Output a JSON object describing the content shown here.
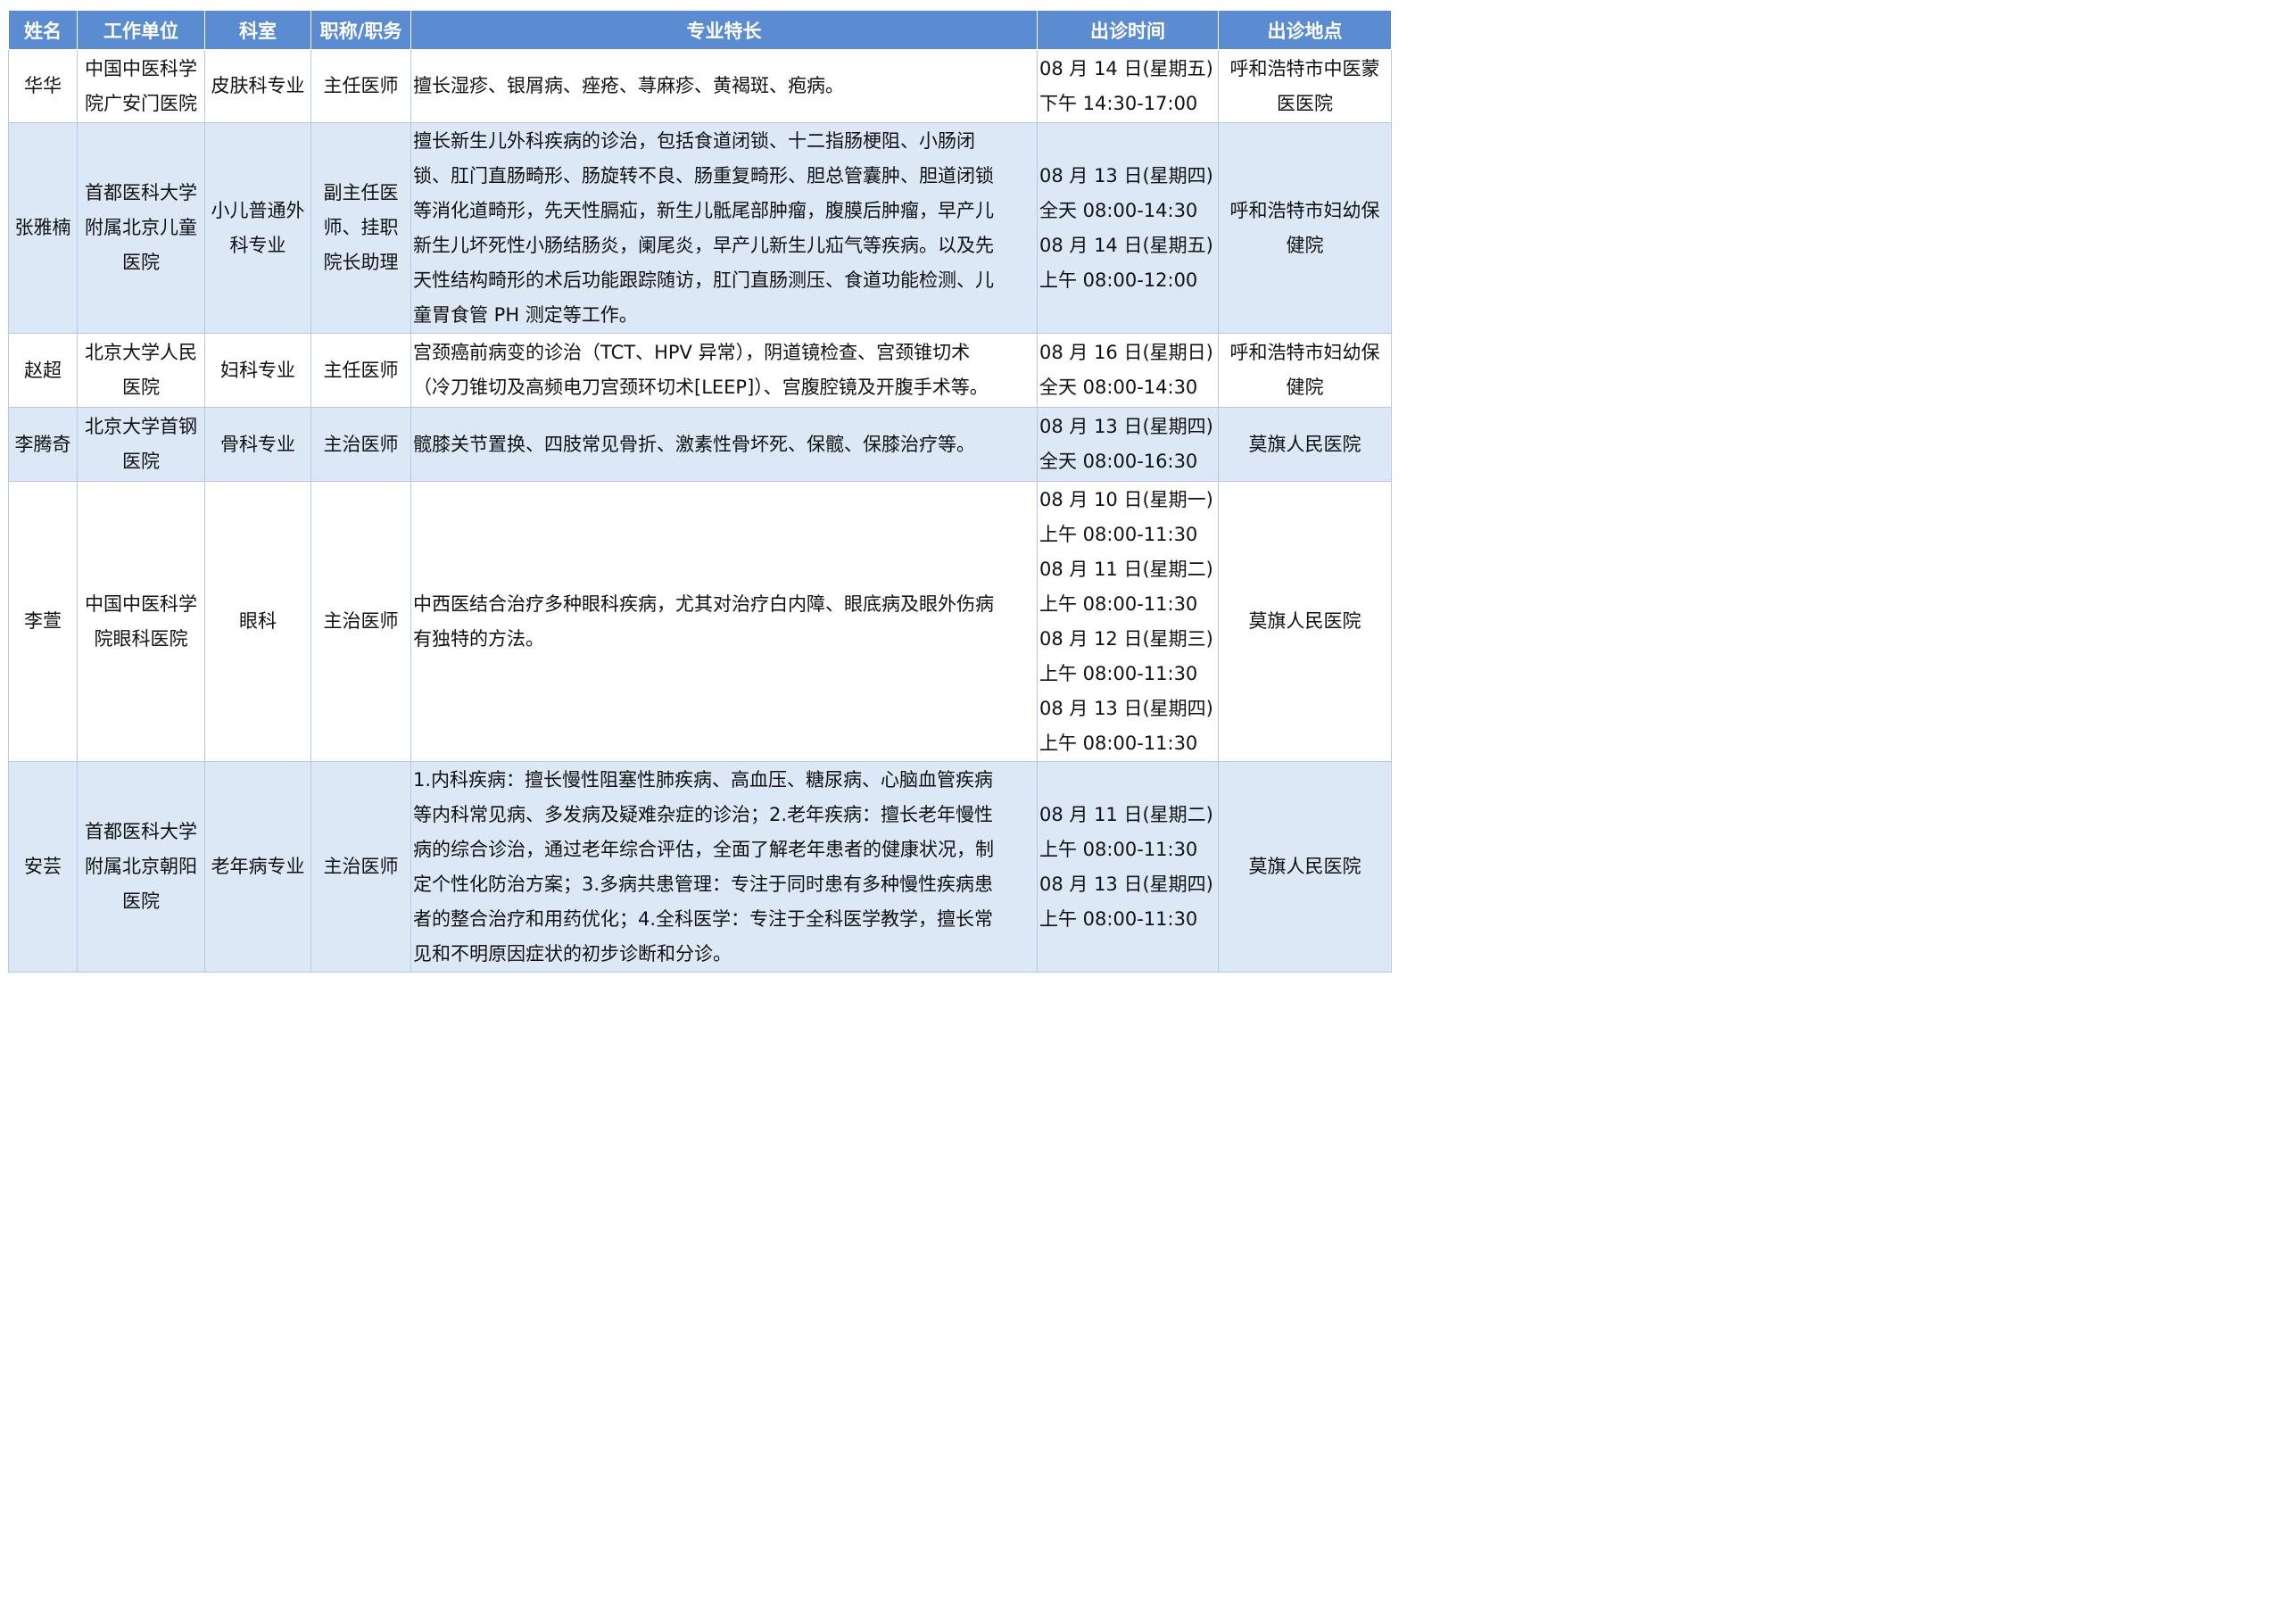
{
  "headers": [
    "姓名",
    "工作单位",
    "科室",
    "职称/职务",
    "专业特长",
    "出诊时间",
    "出诊地点"
  ],
  "rows": [
    {
      "name": "华华",
      "unit": [
        "中国中医科学",
        "院广安门医院"
      ],
      "dept": [
        "皮肤科专业"
      ],
      "title": [
        "主任医师"
      ],
      "specialty": [
        "擅长湿疹、银屑病、痤疮、荨麻疹、黄褐斑、疱病。"
      ],
      "time": [
        "08 月 14 日(星期五)",
        "下午 14:30-17:00"
      ],
      "place": [
        "呼和浩特市中医蒙",
        "医医院"
      ]
    },
    {
      "name": "张雅楠",
      "unit": [
        "首都医科大学",
        "附属北京儿童",
        "医院"
      ],
      "dept": [
        "小儿普通外",
        "科专业"
      ],
      "title": [
        "副主任医",
        "师、挂职",
        "院长助理"
      ],
      "specialty": [
        "擅长新生儿外科疾病的诊治，包括食道闭锁、十二指肠梗阻、小肠闭",
        "锁、肛门直肠畸形、肠旋转不良、肠重复畸形、胆总管囊肿、胆道闭锁",
        "等消化道畸形，先天性膈疝，新生儿骶尾部肿瘤，腹膜后肿瘤，早产儿",
        "新生儿坏死性小肠结肠炎，阑尾炎，早产儿新生儿疝气等疾病。以及先",
        "天性结构畸形的术后功能跟踪随访，肛门直肠测压、食道功能检测、儿",
        "童胃食管 PH 测定等工作。"
      ],
      "time": [
        "08 月 13 日(星期四)",
        "全天 08:00-14:30",
        "08 月 14 日(星期五)",
        "上午 08:00-12:00"
      ],
      "place": [
        "呼和浩特市妇幼保",
        "健院"
      ]
    },
    {
      "name": "赵超",
      "unit": [
        "北京大学人民",
        "医院"
      ],
      "dept": [
        "妇科专业"
      ],
      "title": [
        "主任医师"
      ],
      "specialty": [
        "宫颈癌前病变的诊治（TCT、HPV 异常），阴道镜检查、宫颈锥切术",
        "（冷刀锥切及高频电刀宫颈环切术[LEEP]）、宫腹腔镜及开腹手术等。"
      ],
      "time": [
        "08 月 16 日(星期日)",
        "全天 08:00-14:30"
      ],
      "place": [
        "呼和浩特市妇幼保",
        "健院"
      ]
    },
    {
      "name": "李腾奇",
      "unit": [
        "北京大学首钢",
        "医院"
      ],
      "dept": [
        "骨科专业"
      ],
      "title": [
        "主治医师"
      ],
      "specialty": [
        "髋膝关节置换、四肢常见骨折、激素性骨坏死、保髋、保膝治疗等。"
      ],
      "time": [
        "08 月 13 日(星期四)",
        "全天 08:00-16:30"
      ],
      "place": [
        "莫旗人民医院"
      ]
    },
    {
      "name": "李萱",
      "unit": [
        "中国中医科学",
        "院眼科医院"
      ],
      "dept": [
        "眼科"
      ],
      "title": [
        "主治医师"
      ],
      "specialty": [
        "中西医结合治疗多种眼科疾病，尤其对治疗白内障、眼底病及眼外伤病",
        "有独特的方法。"
      ],
      "time": [
        "08 月 10 日(星期一)",
        "上午 08:00-11:30",
        "08 月 11 日(星期二)",
        "上午 08:00-11:30",
        "08 月 12 日(星期三)",
        "上午 08:00-11:30",
        "08 月 13 日(星期四)",
        "上午 08:00-11:30"
      ],
      "place": [
        "莫旗人民医院"
      ]
    },
    {
      "name": "安芸",
      "unit": [
        "首都医科大学",
        "附属北京朝阳",
        "医院"
      ],
      "dept": [
        "老年病专业"
      ],
      "title": [
        "主治医师"
      ],
      "specialty": [
        "1.内科疾病：擅长慢性阻塞性肺疾病、高血压、糖尿病、心脑血管疾病",
        "等内科常见病、多发病及疑难杂症的诊治；2.老年疾病：擅长老年慢性",
        "病的综合诊治，通过老年综合评估，全面了解老年患者的健康状况，制",
        "定个性化防治方案；3.多病共患管理：专注于同时患有多种慢性疾病患",
        "者的整合治疗和用药优化；4.全科医学：专注于全科医学教学，擅长常",
        "见和不明原因症状的初步诊断和分诊。"
      ],
      "time": [
        "08 月 11 日(星期二)",
        "上午 08:00-11:30",
        "08 月 13 日(星期四)",
        "上午 08:00-11:30"
      ],
      "place": [
        "莫旗人民医院"
      ]
    }
  ]
}
